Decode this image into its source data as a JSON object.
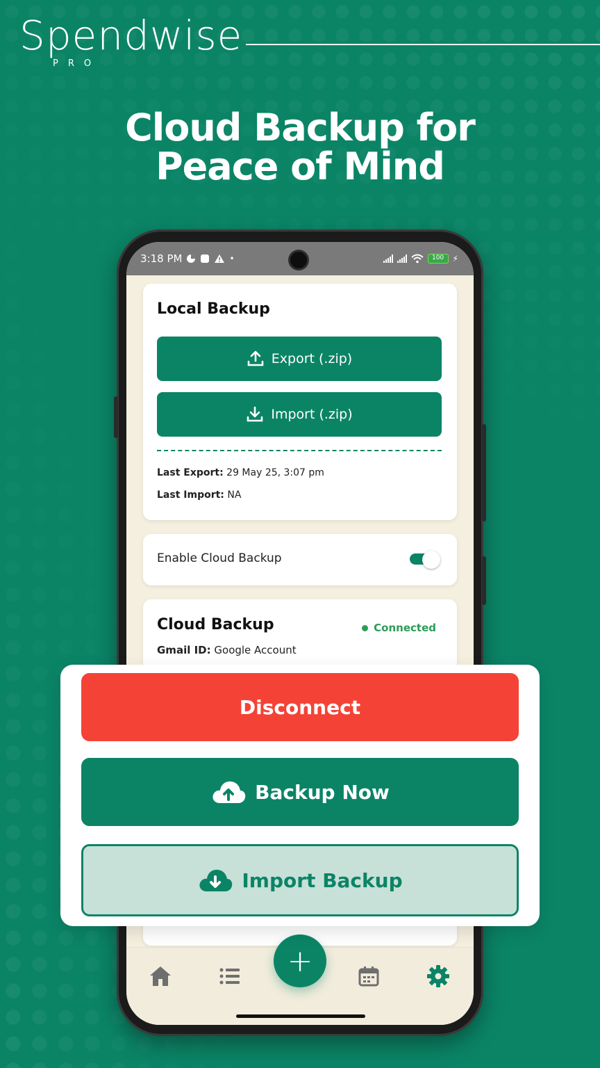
{
  "brand": {
    "name": "Spendwise",
    "sub": "PRO"
  },
  "headline": {
    "line1": "Cloud Backup for",
    "line2": "Peace of Mind"
  },
  "statusbar": {
    "time": "3:18 PM",
    "battery": "100"
  },
  "local_backup": {
    "title": "Local Backup",
    "export_label": "Export (.zip)",
    "import_label": "Import (.zip)",
    "last_export_label": "Last Export:",
    "last_export_value": "29 May 25, 3:07 pm",
    "last_import_label": "Last Import:",
    "last_import_value": "NA"
  },
  "cloud_toggle": {
    "label": "Enable Cloud Backup",
    "enabled": true
  },
  "cloud_backup": {
    "title": "Cloud Backup",
    "status": "Connected",
    "gmail_label": "Gmail ID:",
    "gmail_value": "Google Account"
  },
  "actions": {
    "disconnect": "Disconnect",
    "backup_now": "Backup Now",
    "import_backup": "Import Backup"
  },
  "bottom_nav": {
    "items": [
      "home-icon",
      "list-icon",
      "add-icon",
      "calendar-icon",
      "settings-icon"
    ],
    "active": "settings-icon",
    "fab_symbol": "+"
  },
  "colors": {
    "brand_green": "#0b8466",
    "danger_red": "#f44336",
    "import_bg": "#c7e0d8",
    "screen_bg": "#f4efdf",
    "connected_green": "#2e9b5a"
  }
}
